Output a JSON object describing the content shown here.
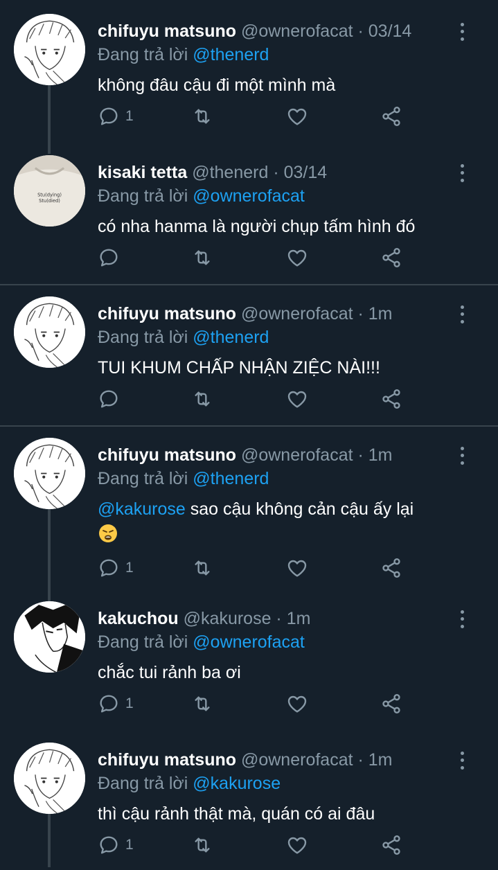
{
  "reply_prefix": "Đang trả lời",
  "tweets": [
    {
      "name": "chifuyu matsuno",
      "handle": "@ownerofacat · 03/14",
      "reply_to": "@thenerd",
      "text": "không đâu cậu đi một mình mà",
      "mention": "",
      "reply_count": "1",
      "avatar": "manga-blond-boy"
    },
    {
      "name": "kisaki tetta",
      "handle": "@thenerd · 03/14",
      "reply_to": "@ownerofacat",
      "text": "có nha hanma là người chụp tấm hình đó",
      "mention": "",
      "reply_count": "",
      "avatar": "tshirt",
      "avatar_text_1": "Stu(dying)",
      "avatar_text_2": "Stu(died)"
    },
    {
      "name": "chifuyu matsuno",
      "handle": "@ownerofacat · 1m",
      "reply_to": "@thenerd",
      "text": "TUI KHUM CHẤP NHẬN ZIỆC NÀI!!!",
      "mention": "",
      "reply_count": "",
      "avatar": "manga-blond-boy"
    },
    {
      "name": "chifuyu matsuno",
      "handle": "@ownerofacat · 1m",
      "reply_to": "@thenerd",
      "mention": "@kakurose",
      "text": " sao cậu không cản cậu ấy lại",
      "reply_count": "1",
      "avatar": "manga-blond-boy",
      "emoji": "weary-face-emoji"
    },
    {
      "name": "kakuchou",
      "handle": "@kakurose · 1m",
      "reply_to": "@ownerofacat",
      "text": "chắc tui rảnh ba ơi",
      "mention": "",
      "reply_count": "1",
      "avatar": "manga-dark-hair-boy"
    },
    {
      "name": "chifuyu matsuno",
      "handle": "@ownerofacat · 1m",
      "reply_to": "@kakurose",
      "text": "thì cậu rảnh thật mà, quán có ai đâu",
      "mention": "",
      "reply_count": "1",
      "avatar": "manga-blond-boy"
    }
  ],
  "icons": [
    "reply-icon",
    "retweet-icon",
    "like-icon",
    "share-icon",
    "more-icon"
  ],
  "colors": {
    "background": "#15202b",
    "divider": "#38444d",
    "secondary_text": "#8899a6",
    "link": "#1da1f2"
  }
}
